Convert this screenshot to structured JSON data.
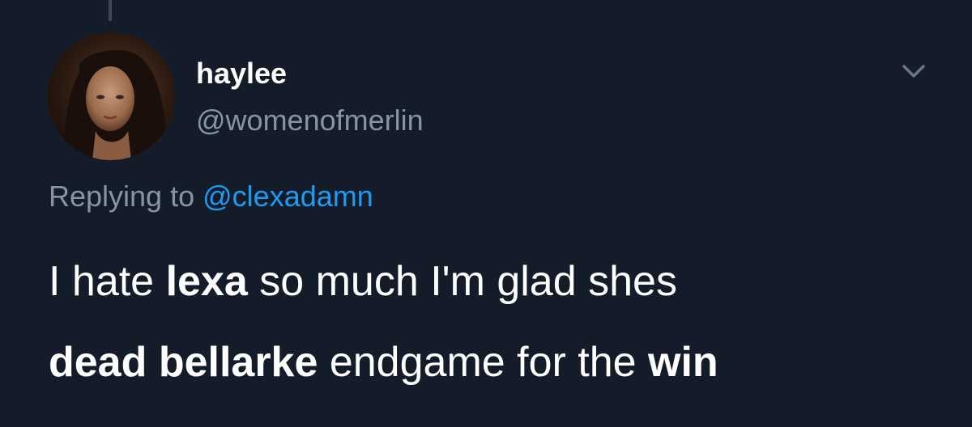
{
  "tweet": {
    "display_name": "haylee",
    "handle": "@womenofmerlin",
    "reply_prefix": "Replying to",
    "reply_mention": "@clexadamn",
    "text_lines": [
      [
        {
          "text": "I hate ",
          "bold": false
        },
        {
          "text": "lexa",
          "bold": true
        },
        {
          "text": " so much I'm glad shes",
          "bold": false
        }
      ],
      [
        {
          "text": "dead bellarke",
          "bold": true
        },
        {
          "text": " endgame for the ",
          "bold": false
        },
        {
          "text": "win",
          "bold": true
        }
      ]
    ]
  },
  "icons": {
    "menu": "chevron-down-icon",
    "avatar": "profile-photo"
  },
  "colors": {
    "background": "#151c29",
    "primary_text": "#ffffff",
    "secondary_text": "#8795a3",
    "link": "#1c9cf0",
    "thread_line": "#3c4653"
  }
}
